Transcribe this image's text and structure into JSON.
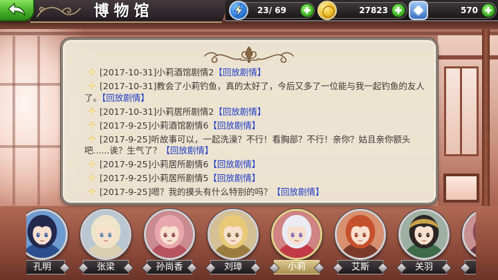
{
  "header": {
    "back_icon": "back-arrow-icon",
    "title": "博物馆"
  },
  "resources": [
    {
      "icon": "lightning-icon",
      "value": "23/ 69",
      "add_icon": "plus-icon"
    },
    {
      "icon": "coin-icon",
      "value": "27823",
      "add_icon": "plus-icon"
    },
    {
      "icon": "gem-icon",
      "value": "570",
      "add_icon": "plus-icon"
    }
  ],
  "panel": {
    "ornament_icon": "fleur-de-lis-ornament-icon",
    "bullet_icon": "star-icon",
    "entries": [
      {
        "date": "[2017-10-31]",
        "text": "小莉酒馆剧情2",
        "link": "【回放剧情】"
      },
      {
        "date": "[2017-10-31]",
        "text": "教会了小莉钓鱼，真的太好了，今后又多了一位能与我一起钓鱼的友人了。",
        "link": "【回放剧情】"
      },
      {
        "date": "[2017-10-31]",
        "text": "小莉居所剧情2",
        "link": "【回放剧情】"
      },
      {
        "date": "[2017-9-25]",
        "text": "小莉酒馆剧情6",
        "link": "【回放剧情】"
      },
      {
        "date": "[2017-9-25]",
        "text": "听故事可以，一起洗澡？不行！看胸部？不行！亲你？姑且亲你额头吧......诶？生气了？",
        "link": "【回放剧情】"
      },
      {
        "date": "[2017-9-25]",
        "text": "小莉居所剧情6",
        "link": "【回放剧情】"
      },
      {
        "date": "[2017-9-25]",
        "text": "小莉居所剧情5",
        "link": "【回放剧情】"
      },
      {
        "date": "[2017-9-25]",
        "text": "嗯？我的摸头有什么特别的吗？",
        "link": "【回放剧情】"
      }
    ]
  },
  "roster": {
    "selected_index": 4,
    "characters": [
      {
        "name": "孔明",
        "bg": "#6e9bd0",
        "hair": "#23294d",
        "eyes": "#3a5a9a",
        "cloth": "#2d4f8e"
      },
      {
        "name": "张梁",
        "bg": "#b9c7d3",
        "hair": "#ede3c6",
        "eyes": "#5a7fa0",
        "cloth": "#d8cfb2",
        "hat": "#efe6cf"
      },
      {
        "name": "孙尚香",
        "bg": "#c98b8f",
        "hair": "#e7a7ad",
        "eyes": "#8b3b4a",
        "cloth": "#b5535e"
      },
      {
        "name": "刘璋",
        "bg": "#d4c094",
        "hair": "#e8c978",
        "eyes": "#6b5a2a",
        "cloth": "#9a7c3e"
      },
      {
        "name": "小莉",
        "bg": "#cf8383",
        "hair": "#eceaf2",
        "eyes": "#7a5ca8",
        "cloth": "#c23a48"
      },
      {
        "name": "艾斯",
        "bg": "#d89070",
        "hair": "#c5512c",
        "eyes": "#a04020",
        "cloth": "#7a3a2a"
      },
      {
        "name": "关羽",
        "bg": "#9eb0a4",
        "hair": "#2b2623",
        "eyes": "#3a3020",
        "cloth": "#3f6b4a",
        "hat": "#c9a24a"
      },
      {
        "bg": "#c89090",
        "hair": "#8a4c5a",
        "eyes": "#5a2a2a",
        "cloth": "#6a3a44"
      }
    ]
  },
  "colors": {
    "accent_green": "#3aa320",
    "link_blue": "#1f3ec6",
    "parchment": "#ece4d3",
    "selected_tag": "#c9b57a"
  }
}
